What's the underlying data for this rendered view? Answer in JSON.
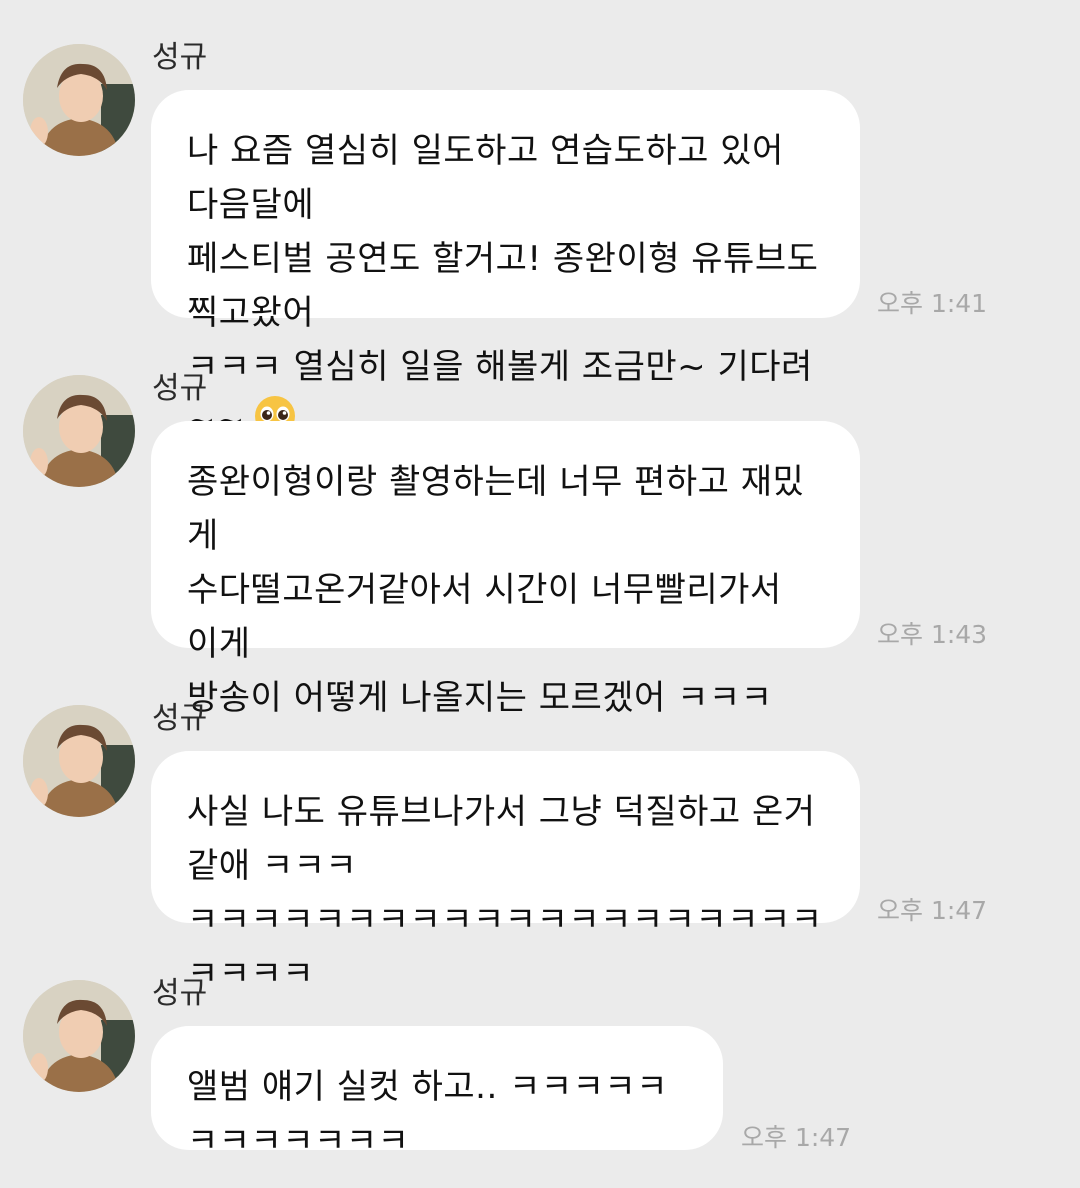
{
  "messages": [
    {
      "sender": "성규",
      "text": "나 요즘 열심히 일도하고 연습도하고 있어 다음달에\n페스티벌 공연도 할거고! 종완이형 유튜브도 찍고왔어\nㅋㅋㅋ 열심히 일을 해볼게 조금만~ 기다려~~",
      "emoji": "pleading-face",
      "time": "오후 1:41"
    },
    {
      "sender": "성규",
      "text": "종완이형이랑 촬영하는데 너무 편하고 재밌게\n수다떨고온거같아서 시간이 너무빨리가서 이게\n방송이 어떻게 나올지는 모르겠어 ㅋㅋㅋ",
      "time": "오후 1:43"
    },
    {
      "sender": "성규",
      "text": "사실 나도 유튜브나가서 그냥 덕질하고 온거같애 ㅋㅋㅋ\nㅋㅋㅋㅋㅋㅋㅋㅋㅋㅋㅋㅋㅋㅋㅋㅋㅋㅋㅋㅋㅋㅋㅋㅋ",
      "time": "오후 1:47"
    },
    {
      "sender": "성규",
      "text": "앨범 얘기 실컷 하고.. ㅋㅋㅋㅋㅋㅋㅋㅋㅋㅋㅋㅋ",
      "time": "오후 1:47"
    }
  ],
  "colors": {
    "background": "#ebebeb",
    "bubble": "#ffffff",
    "time": "#a8a8a8"
  }
}
